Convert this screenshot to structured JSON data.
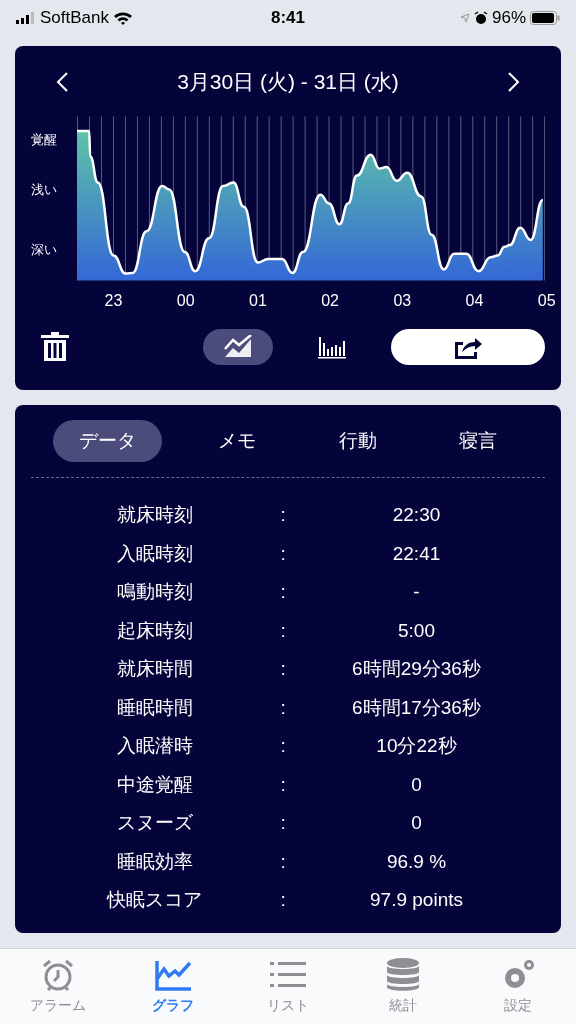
{
  "status_bar": {
    "carrier": "SoftBank",
    "time": "8:41",
    "battery": "96%"
  },
  "graph_card": {
    "date_range": "3月30日 (火) - 31日 (水)",
    "y_labels": [
      "覚醒",
      "浅い",
      "深い"
    ],
    "x_labels": [
      "23",
      "00",
      "01",
      "02",
      "03",
      "04",
      "05"
    ],
    "view_toggles": [
      {
        "kind": "line",
        "selected": true
      },
      {
        "kind": "bar",
        "selected": false
      }
    ]
  },
  "tabs": [
    {
      "label": "データ",
      "selected": true
    },
    {
      "label": "メモ",
      "selected": false
    },
    {
      "label": "行動",
      "selected": false
    },
    {
      "label": "寝言",
      "selected": false
    }
  ],
  "rows": [
    {
      "label": "就床時刻",
      "sep": ":",
      "value": "22:30"
    },
    {
      "label": "入眠時刻",
      "sep": ":",
      "value": "22:41"
    },
    {
      "label": "鳴動時刻",
      "sep": ":",
      "value": "-"
    },
    {
      "label": "起床時刻",
      "sep": ":",
      "value": "5:00"
    },
    {
      "label": "就床時間",
      "sep": ":",
      "value": "6時間29分36秒"
    },
    {
      "label": "睡眠時間",
      "sep": ":",
      "value": "6時間17分36秒"
    },
    {
      "label": "入眠潜時",
      "sep": ":",
      "value": "10分22秒"
    },
    {
      "label": "中途覚醒",
      "sep": ":",
      "value": "0"
    },
    {
      "label": "スヌーズ",
      "sep": ":",
      "value": "0"
    },
    {
      "label": "睡眠効率",
      "sep": ":",
      "value": "96.9 %"
    },
    {
      "label": "快眠スコア",
      "sep": ":",
      "value": "97.9 points"
    }
  ],
  "tab_bar": [
    {
      "kind": "alarm",
      "label": "アラーム",
      "selected": false
    },
    {
      "kind": "graph",
      "label": "グラフ",
      "selected": true
    },
    {
      "kind": "list",
      "label": "リスト",
      "selected": false
    },
    {
      "kind": "stats",
      "label": "統計",
      "selected": false
    },
    {
      "kind": "settings",
      "label": "設定",
      "selected": false
    }
  ]
}
